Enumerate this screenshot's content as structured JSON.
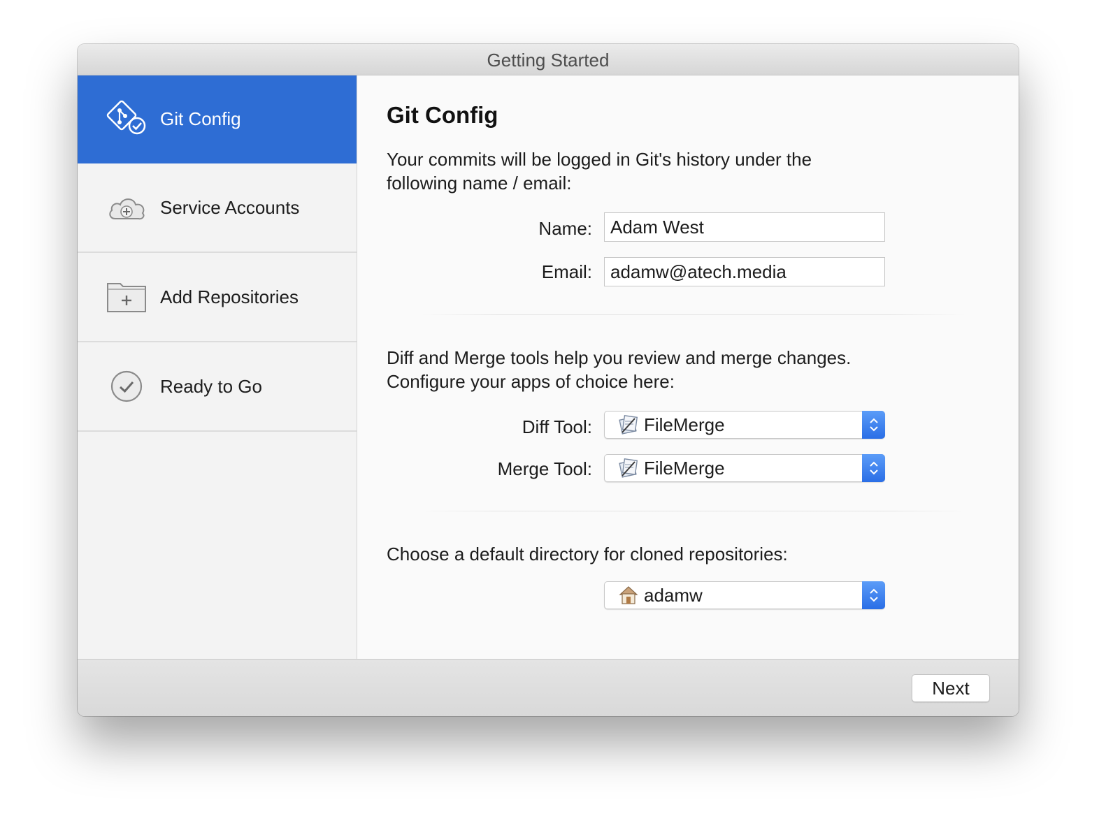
{
  "window": {
    "title": "Getting Started"
  },
  "sidebar": {
    "items": [
      {
        "label": "Git Config",
        "icon": "git-config-icon",
        "active": true
      },
      {
        "label": "Service Accounts",
        "icon": "cloud-plus-icon",
        "active": false
      },
      {
        "label": "Add Repositories",
        "icon": "folder-plus-icon",
        "active": false
      },
      {
        "label": "Ready to Go",
        "icon": "checkmark-circle-icon",
        "active": false
      }
    ]
  },
  "main": {
    "title": "Git Config",
    "identity": {
      "description": "Your commits will be logged in Git's history under the following name / email:",
      "name_label": "Name:",
      "name_value": "Adam West",
      "email_label": "Email:",
      "email_value": "adamw@atech.media"
    },
    "tools": {
      "description": "Diff and Merge tools help you review and merge changes. Configure your apps of choice here:",
      "diff_label": "Diff Tool:",
      "diff_value": "FileMerge",
      "merge_label": "Merge Tool:",
      "merge_value": "FileMerge"
    },
    "directory": {
      "description": "Choose a default directory for cloned repositories:",
      "value": "adamw"
    }
  },
  "footer": {
    "next_label": "Next"
  },
  "colors": {
    "accent": "#2e6dd4",
    "stepper": "#2a6ee6"
  }
}
